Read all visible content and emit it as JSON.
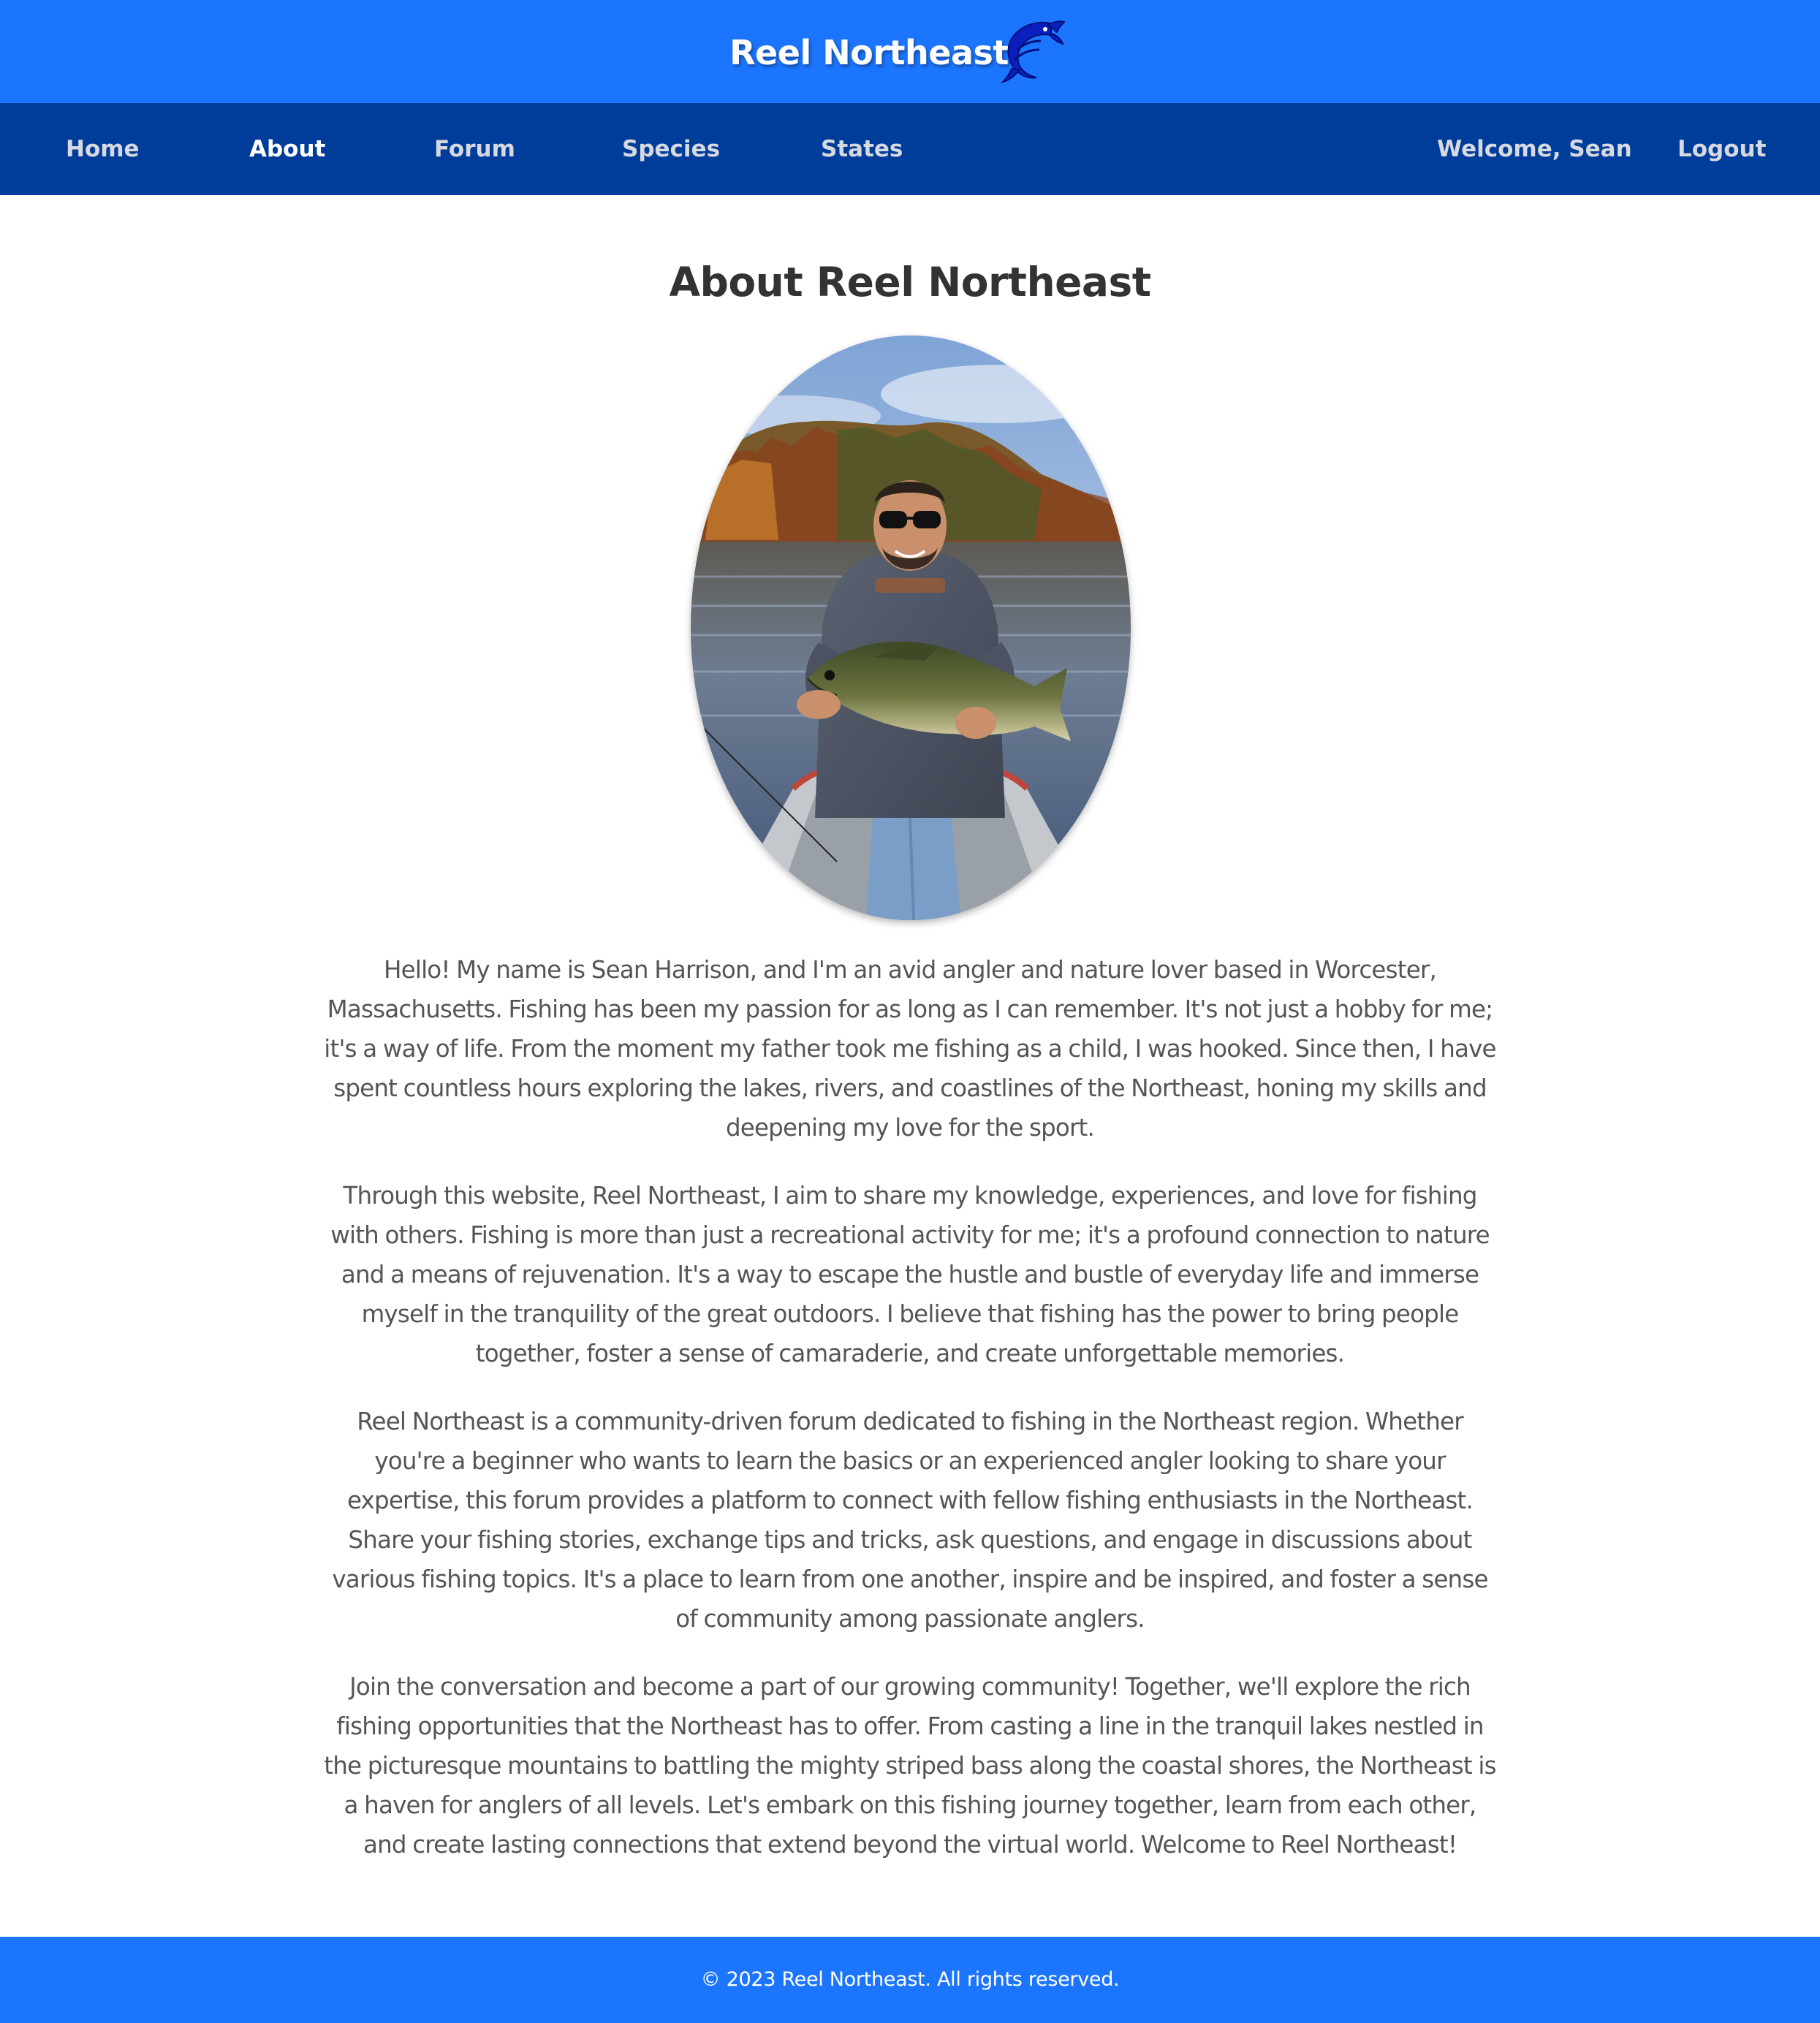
{
  "header": {
    "title": "Reel Northeast",
    "logo_icon": "jumping-fish-icon"
  },
  "nav": {
    "home": "Home",
    "about": "About",
    "forum": "Forum",
    "species": "Species",
    "states": "States",
    "welcome": "Welcome, Sean",
    "logout": "Logout",
    "active": "About"
  },
  "main": {
    "heading": "About Reel Northeast",
    "paragraphs": [
      "Hello! My name is Sean Harrison, and I'm an avid angler and nature lover based in Worcester, Massachusetts. Fishing has been my passion for as long as I can remember. It's not just a hobby for me; it's a way of life. From the moment my father took me fishing as a child, I was hooked. Since then, I have spent countless hours exploring the lakes, rivers, and coastlines of the Northeast, honing my skills and deepening my love for the sport.",
      "Through this website, Reel Northeast, I aim to share my knowledge, experiences, and love for fishing with others. Fishing is more than just a recreational activity for me; it's a profound connection to nature and a means of rejuvenation. It's a way to escape the hustle and bustle of everyday life and immerse myself in the tranquility of the great outdoors. I believe that fishing has the power to bring people together, foster a sense of camaraderie, and create unforgettable memories.",
      "Reel Northeast is a community-driven forum dedicated to fishing in the Northeast region. Whether you're a beginner who wants to learn the basics or an experienced angler looking to share your expertise, this forum provides a platform to connect with fellow fishing enthusiasts in the Northeast. Share your fishing stories, exchange tips and tricks, ask questions, and engage in discussions about various fishing topics. It's a place to learn from one another, inspire and be inspired, and foster a sense of community among passionate anglers.",
      "Join the conversation and become a part of our growing community! Together, we'll explore the rich fishing opportunities that the Northeast has to offer. From casting a line in the tranquil lakes nestled in the picturesque mountains to battling the mighty striped bass along the coastal shores, the Northeast is a haven for anglers of all levels. Let's embark on this fishing journey together, learn from each other, and create lasting connections that extend beyond the virtual world. Welcome to Reel Northeast!"
    ]
  },
  "footer": {
    "copyright": "© 2023 Reel Northeast. All rights reserved."
  },
  "colors": {
    "header_bg": "#1c75fe",
    "nav_bg": "#003d9a",
    "nav_text": "#d6d9df",
    "heading_text": "#333333",
    "body_text": "#555555"
  }
}
